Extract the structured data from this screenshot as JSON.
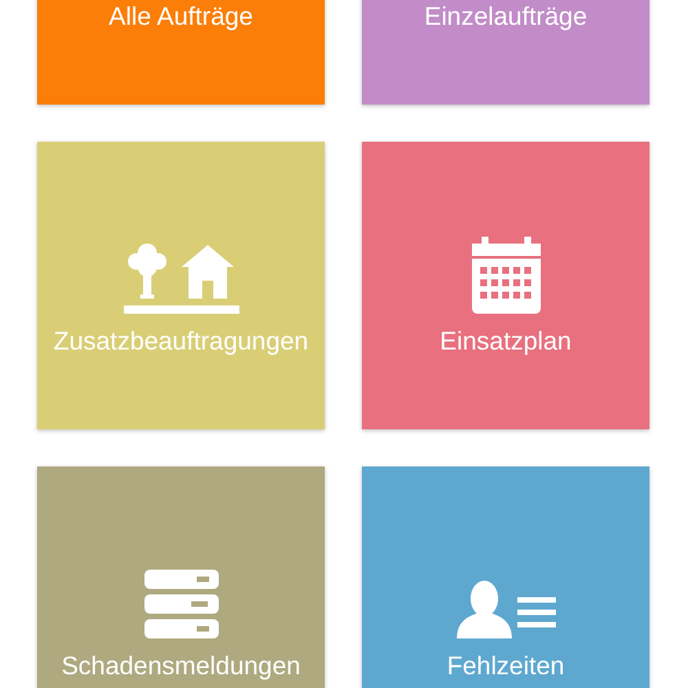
{
  "tiles": [
    {
      "label": "Alle Aufträge",
      "color": "#fb7e08"
    },
    {
      "label": "Einzelaufträge",
      "color": "#c18cc8"
    },
    {
      "label": "Zusatzbeauftragungen",
      "color": "#d9ce75",
      "kind": "trees-house"
    },
    {
      "label": "Einsatzplan",
      "color": "#e8707f",
      "kind": "calendar"
    },
    {
      "label": "Schadensmeldungen",
      "color": "#aea97f",
      "kind": "server"
    },
    {
      "label": "Fehlzeiten",
      "color": "#5ea8d0",
      "kind": "person-list"
    }
  ]
}
